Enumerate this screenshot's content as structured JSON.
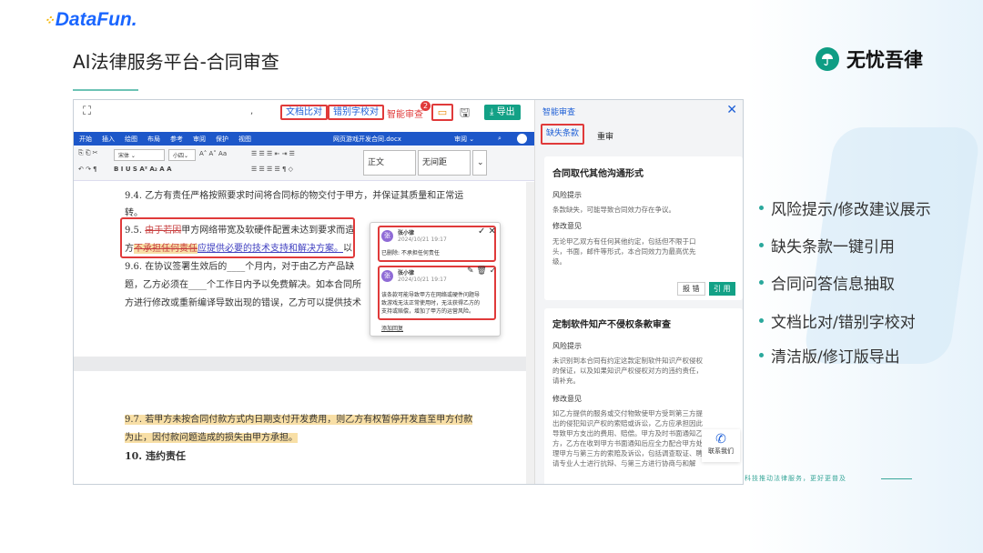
{
  "logo": {
    "text": "DataFun."
  },
  "page_title": "AI法律服务平台-合同审查",
  "brand": {
    "name": "无忧吾律"
  },
  "toolbar": {
    "compare": "文档比对",
    "typo": "错别字校对",
    "smart": "智能审查",
    "badge": "2",
    "export": "导出",
    "dot": ","
  },
  "word": {
    "tabs": [
      "开始",
      "插入",
      "绘图",
      "布局",
      "参考",
      "审阅",
      "保护",
      "视图"
    ],
    "doc_name": "网页游戏开发合同.docx",
    "font": "宋体",
    "size": "小四",
    "style1": "正文",
    "style2": "无间距",
    "review": "审阅"
  },
  "doc": {
    "l1": "9.4.  乙方有责任严格按照要求时间将合同标的物交付于甲方，并保证其质量和正常运",
    "l2": "转。",
    "l3a": "9.5.  ",
    "l3del": "由于若因",
    "l3b": "甲方网络带宽及软硬件配置未达到要求而造",
    "l4a": "方",
    "l4del": "不承担任何责任",
    "l4ins": "应提供必要的技术支持和解决方案。",
    "l4b": "以",
    "l5": "9.6.  在协议签署生效后的____个月内，对于由乙方产品缺",
    "l6": "题，乙方必须在____个工作日内予以免费解决。如本合同所",
    "l7": "方进行修改或重新编译导致出现的错误，乙方可以提供技术",
    "l8": "9.7.  若甲方未按合同付款方式内日期支付开发费用，则乙方有权暂停开发直至甲方付款",
    "l9": "为止，因付款问题造成的损失由甲方承担。",
    "l10": "10.  违约责任"
  },
  "comments": [
    {
      "avatar": "张",
      "user": "张小律",
      "time": "2024/10/21 19:17",
      "text": "已删除: 不承担任何责任"
    },
    {
      "avatar": "张",
      "user": "张小律",
      "time": "2024/10/21 19:17",
      "text": [
        "该条款可能导致甲方在网络或硬件问题导",
        "致游戏无法正常使用时，无法获得乙方的",
        "支持或赔偿，增加了甲方的运营风险。"
      ]
    }
  ],
  "add_reply": "添加回复",
  "panel": {
    "title": "智能审查",
    "tab_missing": "缺失条款",
    "tab_review": "重审",
    "cards": [
      {
        "title": "合同取代其他沟通形式",
        "risk_label": "风险提示",
        "risk": "条款缺失，可能导致合同效力存在争议。",
        "advice_label": "修改意见",
        "advice": [
          "无论甲乙双方有任何其他约定，包括但不限于口",
          "头，书面，邮件等形式，本合同效力为最高优先",
          "级。"
        ],
        "report": "报 错",
        "cite": "引 用"
      },
      {
        "title": "定制软件知产不侵权条款审查",
        "risk_label": "风险提示",
        "risk": [
          "未识别到本合同有约定这款定制软件知识产权侵权",
          "的保证，以及如果知识产权侵权对方的违约责任，",
          "请补充。"
        ],
        "advice_label": "修改意见",
        "advice": [
          "如乙方提供的服务或交付物致使甲方受到第三方提",
          "出的侵犯知识产权的索赔或诉讼，乙方应承担因此",
          "导致甲方支出的费用、赔偿。甲方及时书面通知乙",
          "方，乙方在收到甲方书面通知后应全力配合甲方处",
          "理甲方与第三方的索赔及诉讼，包括调查取证、聘",
          "请专业人士进行抗辩、与第三方进行协商与和解"
        ]
      }
    ],
    "contact": "联系我们"
  },
  "features": [
    "风险提示/修改建议展示",
    "缺失条款一键引用",
    "合同问答信息抽取",
    "文档比对/错别字校对",
    "清洁版/修订版导出"
  ],
  "slogan": "科技推动法律服务，更好更普及",
  "colors": {
    "accent": "#13a186",
    "link": "#1e5fd6",
    "highlight": "#e03a3a"
  }
}
